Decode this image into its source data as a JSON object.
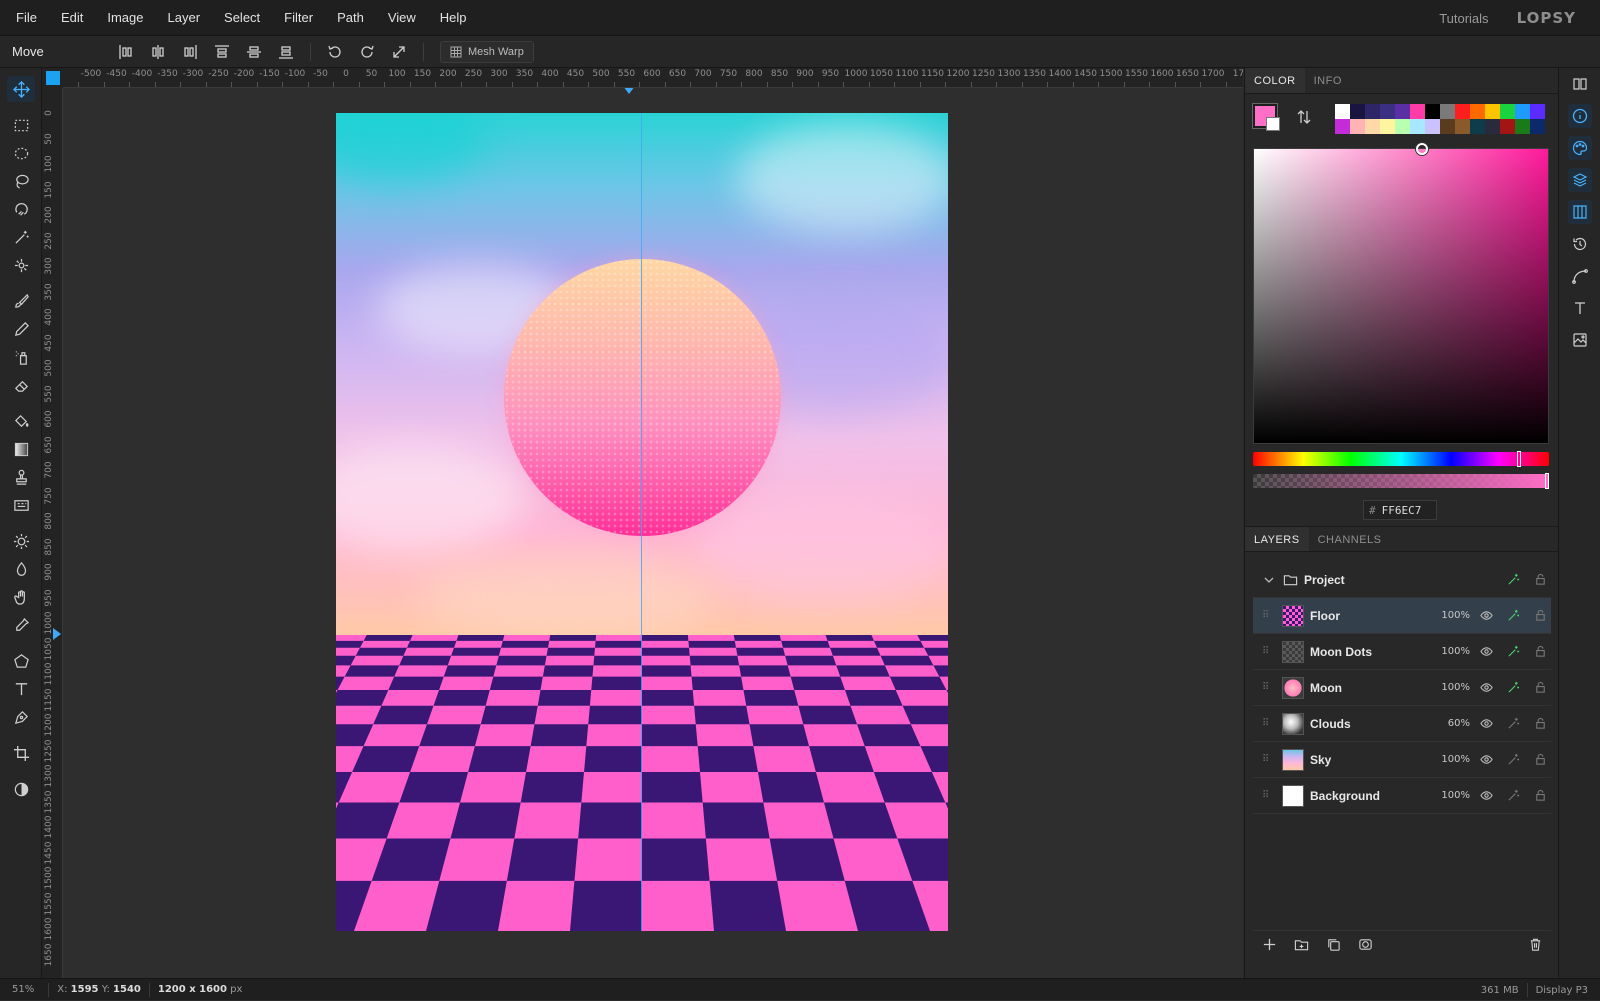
{
  "menu": [
    "File",
    "Edit",
    "Image",
    "Layer",
    "Select",
    "Filter",
    "Path",
    "View",
    "Help"
  ],
  "topright": {
    "tutorials": "Tutorials",
    "logo": "LOPSY"
  },
  "options": {
    "tool_name": "Move",
    "mesh_warp": "Mesh Warp"
  },
  "ruler_top": [
    "-500",
    "-450",
    "-400",
    "-350",
    "-300",
    "-250",
    "-200",
    "-150",
    "-100",
    "-50",
    "0",
    "50",
    "100",
    "150",
    "200",
    "250",
    "300",
    "350",
    "400",
    "450",
    "500",
    "550",
    "600",
    "650",
    "700",
    "750",
    "800",
    "850",
    "900",
    "950",
    "1000",
    "1050",
    "1100",
    "1150",
    "1200",
    "1250",
    "1300",
    "1350",
    "1400",
    "1450",
    "1500",
    "1550",
    "1600",
    "1650",
    "1700",
    "17"
  ],
  "ruler_left": [
    "0",
    "50",
    "100",
    "150",
    "200",
    "250",
    "300",
    "350",
    "400",
    "450",
    "500",
    "550",
    "600",
    "650",
    "700",
    "750",
    "800",
    "850",
    "900",
    "950",
    "1000",
    "1050",
    "1100",
    "1150",
    "1200",
    "1250",
    "1300",
    "1350",
    "1400",
    "1450",
    "1500",
    "1550",
    "1600",
    "1650"
  ],
  "color_panel": {
    "tabs": [
      "COLOR",
      "INFO"
    ],
    "hex_label": "#",
    "hex_value": "FF6EC7",
    "foreground": "#ff6ec7",
    "background": "#ffffff",
    "palette": [
      "#ffffff",
      "#1a1440",
      "#2d2566",
      "#3b2f83",
      "#5a2fa3",
      "#ff3ba8",
      "#000000",
      "#7a7a7a",
      "#ff1e1e",
      "#ff6a00",
      "#ffc400",
      "#1bd33e",
      "#1e9bff",
      "#5b2bff",
      "#c42bd9",
      "#ffb3b3",
      "#ffd9a8",
      "#fff5a0",
      "#b8ffb0",
      "#a8e8ff",
      "#c9c2ff",
      "#5b3b1e",
      "#8a5a2b",
      "#0e3c4a",
      "#2a2a3d",
      "#a31515",
      "#1a7a1a",
      "#0c2a6b"
    ]
  },
  "layers_panel": {
    "tabs": [
      "LAYERS",
      "CHANNELS"
    ],
    "folder": {
      "name": "Project"
    },
    "layers": [
      {
        "name": "Floor",
        "opacity": "100%",
        "selected": true,
        "thumb": "floor"
      },
      {
        "name": "Moon Dots",
        "opacity": "100%",
        "selected": false,
        "thumb": "dots"
      },
      {
        "name": "Moon",
        "opacity": "100%",
        "selected": false,
        "thumb": "moon"
      },
      {
        "name": "Clouds",
        "opacity": "60%",
        "selected": false,
        "thumb": "clouds"
      },
      {
        "name": "Sky",
        "opacity": "100%",
        "selected": false,
        "thumb": "sky"
      },
      {
        "name": "Background",
        "opacity": "100%",
        "selected": false,
        "thumb": "white"
      }
    ]
  },
  "status": {
    "zoom": "51%",
    "x_label": "X:",
    "x": "1595",
    "y_label": "Y:",
    "y": "1540",
    "size": "1200 x 1600",
    "unit": "px",
    "memory": "361 MB",
    "profile": "Display P3"
  }
}
